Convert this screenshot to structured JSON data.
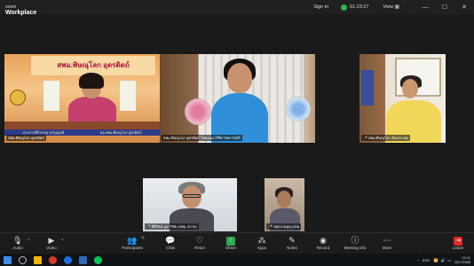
{
  "app": {
    "brand_small": "zoom",
    "brand_large": "Workplace"
  },
  "titlebar": {
    "signin": "Sign in",
    "timer": "01:23:27",
    "view": "View",
    "minimize": "—",
    "maximize": "☐",
    "close": "✕"
  },
  "tiles": [
    {
      "id": "t1",
      "label": "สพม.พิษณุโลก อุตรดิตถ์",
      "banner": "สพม.พิษณุโลก อุตรดิตถ์",
      "caption_left": "นางสาวศิริวรรณ ขวัญญอดี",
      "caption_right": "ผอ.สพม.พิษณุโลก อุตรดิตถ์",
      "muted": false
    },
    {
      "id": "t2",
      "label": "สพม.พิษณุโลก อุตรดิตถ์ ไซคอนอาร์ชีฟ ไชยาวัดมีร์",
      "muted": false
    },
    {
      "id": "t3",
      "label": "สพม.พิษณุโลก ห้องประชุม",
      "muted": true
    },
    {
      "id": "t4",
      "label": "ศิริรัตน์ ภูมาวิชัย (สพฐ. ตรวจ)",
      "muted": true
    },
    {
      "id": "t5",
      "label": "ขอสงวนคุณ ตรม",
      "muted": true
    }
  ],
  "toolbar": {
    "audio": "Audio",
    "video": "Video",
    "participants": "Participants",
    "participants_count": "11",
    "chat": "Chat",
    "react": "React",
    "share": "Share",
    "apps": "Apps",
    "notes": "Notes",
    "record": "Record",
    "meeting_info": "Meeting info",
    "more": "More",
    "leave": "Leave"
  },
  "taskbar": {
    "lang": "ENG",
    "time": "13:11",
    "date": "25/7/2568"
  },
  "colors": {
    "share": "#2da94f",
    "leave": "#e02828",
    "shield": "#2db84a"
  }
}
